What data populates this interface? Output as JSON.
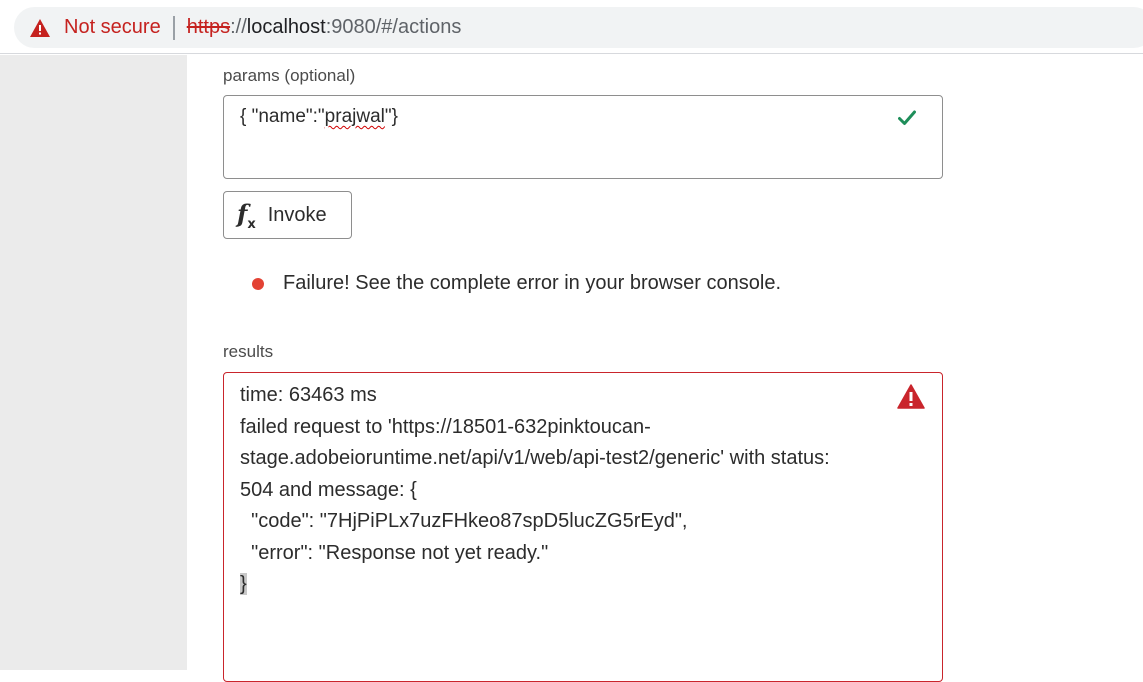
{
  "browser": {
    "security_label": "Not secure",
    "url_scheme": "https",
    "url_separator": "://",
    "url_host": "localhost",
    "url_rest": ":9080/#/actions"
  },
  "params": {
    "label": "params (optional)",
    "value_prefix": "{ \"name\":\"",
    "value_misspelled": "prajwal",
    "value_suffix": "\"}"
  },
  "invoke": {
    "icon": "function-icon",
    "icon_main": "f",
    "icon_sub": "x",
    "label": "Invoke"
  },
  "status": {
    "color": "#e34234",
    "message": "Failure! See the complete error in your browser console."
  },
  "results": {
    "label": "results",
    "lines": [
      "time: 63463 ms",
      "failed request to 'https://18501-632pinktoucan-",
      "stage.adobeioruntime.net/api/v1/web/api-test2/generic' with status:",
      "504 and message: {",
      "  \"code\": \"7HjPiPLx7uzFHkeo87spD5lucZG5rEyd\",",
      "  \"error\": \"Response not yet ready.\""
    ],
    "last_line": "}"
  },
  "colors": {
    "error_red": "#c9252c",
    "success_green": "#1e8e5a",
    "insecure_red": "#c5221f"
  }
}
